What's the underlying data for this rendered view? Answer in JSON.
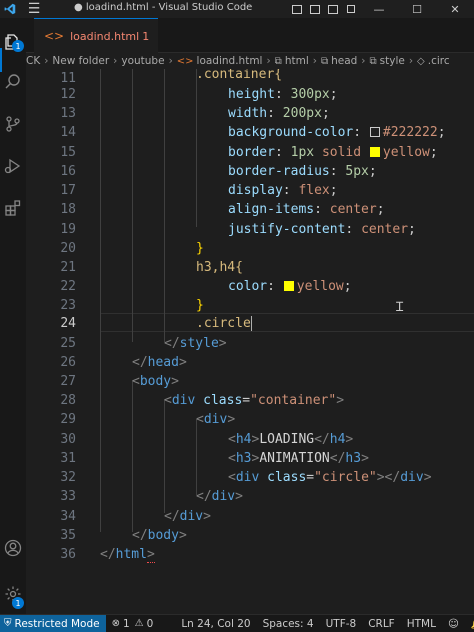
{
  "window": {
    "title": "● loadind.html - Visual Studio Code",
    "menu_icon": "hamburger-menu-icon",
    "minimize": "—",
    "maximize": "☐",
    "close": "✕"
  },
  "activity_bar": {
    "items": [
      "explorer-icon",
      "search-icon",
      "source-control-icon",
      "run-debug-icon",
      "extensions-icon",
      "account-icon",
      "settings-gear-icon"
    ],
    "explorer_badge": "1",
    "settings_badge": "1"
  },
  "tab": {
    "label": "loadind.html",
    "problem_count": "1",
    "icon": "html-file-icon"
  },
  "breadcrumb": {
    "items": [
      "CK",
      "New folder",
      "youtube",
      "loadind.html",
      "html",
      "head",
      "style",
      ".circ"
    ]
  },
  "editor": {
    "line_numbers": [
      "11",
      "12",
      "13",
      "14",
      "15",
      "16",
      "17",
      "18",
      "19",
      "20",
      "21",
      "22",
      "23",
      "24",
      "25",
      "26",
      "27",
      "28",
      "29",
      "30",
      "31",
      "32",
      "33",
      "34",
      "35",
      "36"
    ],
    "active_line": "24",
    "code": {
      "l11_sel": ".container{",
      "l12_prop": "height",
      "l12_val": "300px",
      "l13_prop": "width",
      "l13_val": "200px",
      "l14_prop": "background-color",
      "l14_val": "#222222",
      "l15_prop": "border",
      "l15_val1": "1px",
      "l15_val2": "solid",
      "l15_val3": "yellow",
      "l16_prop": "border-radius",
      "l16_val": "5px",
      "l17_prop": "display",
      "l17_val": "flex",
      "l18_prop": "align-items",
      "l18_val": "center",
      "l19_prop": "justify-content",
      "l19_val": "center",
      "l20": "}",
      "l21_sel": "h3,h4{",
      "l22_prop": "color",
      "l22_val": "yellow",
      "l23": "}",
      "l24_sel": ".circle",
      "l25_tag": "style",
      "l26_tag": "head",
      "l27_tag": "body",
      "l28_tag": "div",
      "l28_attr": "class",
      "l28_str": "\"container\"",
      "l29_tag": "div",
      "l30_tag": "h4",
      "l30_text": "LOADING",
      "l31_tag": "h3",
      "l31_text": "ANIMATION",
      "l32_tag": "div",
      "l32_attr": "class",
      "l32_str": "\"circle\"",
      "l33_tag": "div",
      "l34_tag": "div",
      "l35_tag": "body",
      "l36_tag": "html"
    },
    "swatch_colors": {
      "dark": "#222222",
      "yellow": "#ffff00"
    }
  },
  "status_bar": {
    "restricted_mode": "Restricted Mode",
    "errors": "1",
    "warnings": "0",
    "position": "Ln 24, Col 20",
    "spaces": "Spaces: 4",
    "encoding": "UTF-8",
    "eol": "CRLF",
    "language": "HTML",
    "feedback_icon": "feedback-icon",
    "notifications_icon": "bell-icon"
  },
  "colors": {
    "accent": "#0078d4",
    "restricted_bg": "#0e639c"
  }
}
